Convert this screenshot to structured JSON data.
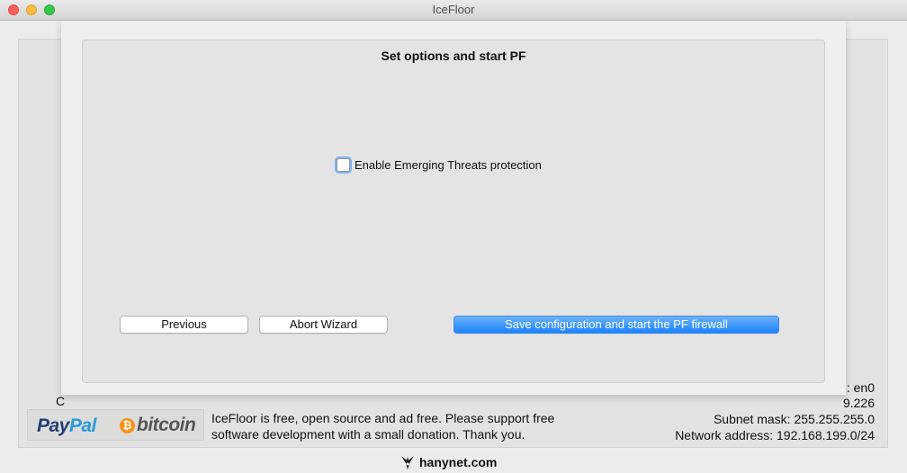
{
  "window": {
    "title": "IceFloor"
  },
  "wizard": {
    "title": "Set options and start PF",
    "checkbox_label": "Enable Emerging Threats protection",
    "checkbox_checked": false,
    "previous_label": "Previous",
    "abort_label": "Abort Wizard",
    "save_label": "Save configuration and start the PF firewall"
  },
  "background": {
    "left_partial": "C",
    "interface_partial": ": en0",
    "ip_partial": "9.226",
    "subnet_mask": "Subnet mask: 255.255.255.0",
    "network_address": "Network address: 192.168.199.0/24"
  },
  "donate": {
    "paypal_pay": "Pay",
    "paypal_pal": "Pal",
    "bitcoin_symbol": "₿",
    "bitcoin_word": "bitcoin",
    "line1": "IceFloor is free, open source and ad free. Please support free",
    "line2": "software development with a small donation. Thank you."
  },
  "footer": {
    "brand": "hanynet.com"
  },
  "colors": {
    "accent": "#1a82fb",
    "paypal_dark": "#233f72",
    "paypal_light": "#2a9ad8",
    "bitcoin": "#f7931a"
  }
}
